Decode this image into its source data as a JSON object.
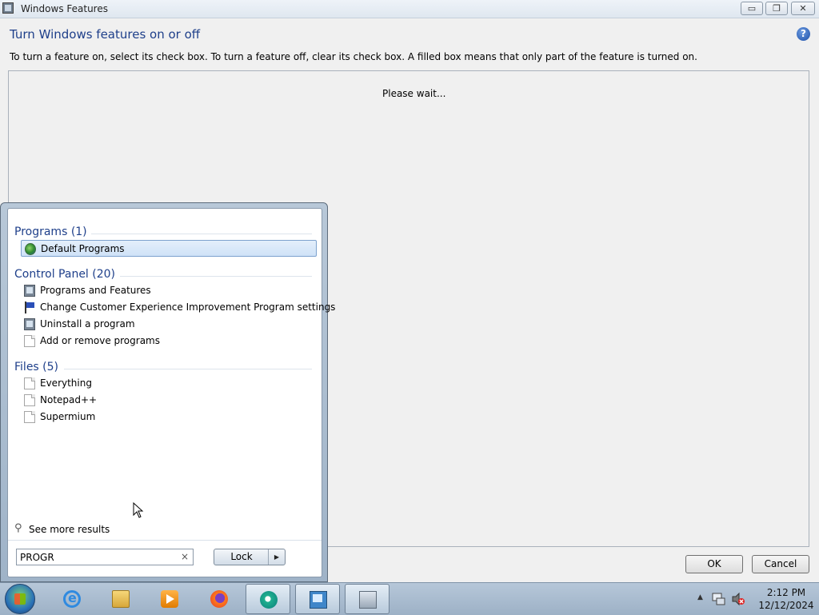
{
  "window": {
    "title": "Windows Features",
    "heading": "Turn Windows features on or off",
    "instructions": "To turn a feature on, select its check box. To turn a feature off, clear its check box. A filled box means that only part of the feature is turned on.",
    "status": "Please wait...",
    "help_glyph": "?",
    "ok_label": "OK",
    "cancel_label": "Cancel",
    "min_glyph": "▭",
    "max_glyph": "❐",
    "close_glyph": "✕"
  },
  "start_menu": {
    "groups": [
      {
        "title": "Programs (1)",
        "items": [
          {
            "label": "Default Programs",
            "icon": "default-programs-icon",
            "selected": true
          }
        ]
      },
      {
        "title": "Control Panel (20)",
        "items": [
          {
            "label": "Programs and Features",
            "icon": "control-panel-icon"
          },
          {
            "label": "Change Customer Experience Improvement Program settings",
            "icon": "flag-icon"
          },
          {
            "label": "Uninstall a program",
            "icon": "control-panel-icon"
          },
          {
            "label": "Add or remove programs",
            "icon": "document-icon"
          }
        ]
      },
      {
        "title": "Files (5)",
        "items": [
          {
            "label": "Everything",
            "icon": "document-icon"
          },
          {
            "label": "Notepad++",
            "icon": "document-icon"
          },
          {
            "label": "Supermium",
            "icon": "document-icon"
          }
        ]
      }
    ],
    "see_more": "See more results",
    "search_value": "PROGR",
    "clear_glyph": "×",
    "lock_label": "Lock",
    "lock_arrow": "▶"
  },
  "taskbar": {
    "apps": [
      "internet-explorer",
      "windows-explorer",
      "media-player",
      "firefox",
      "app",
      "control-panel",
      "windows-features"
    ],
    "clock_time": "2:12 PM",
    "clock_date": "12/12/2024",
    "tray_arrow": "▲"
  }
}
